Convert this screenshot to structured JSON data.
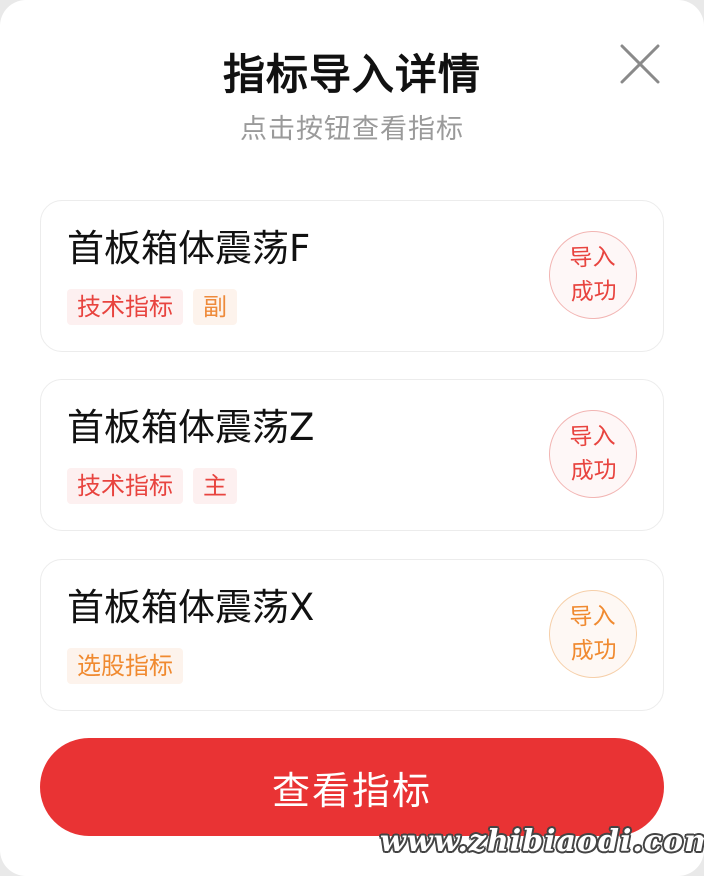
{
  "dialog": {
    "title": "指标导入详情",
    "subtitle": "点击按钮查看指标",
    "close_icon": "close-icon"
  },
  "items": [
    {
      "name": "首板箱体震荡F",
      "tags": [
        "技术指标",
        "副"
      ],
      "status_line1": "导入",
      "status_line2": "成功"
    },
    {
      "name": "首板箱体震荡Z",
      "tags": [
        "技术指标",
        "主"
      ],
      "status_line1": "导入",
      "status_line2": "成功"
    },
    {
      "name": "首板箱体震荡X",
      "tags": [
        "选股指标"
      ],
      "status_line1": "导入",
      "status_line2": "成功"
    }
  ],
  "footer": {
    "view_button_label": "查看指标",
    "watermark": "www.zhibiaodi.com"
  },
  "colors": {
    "accent_red": "#e93334",
    "tag_red": "#e8443f",
    "tag_orange": "#f08a30",
    "title": "#111111",
    "subtitle": "#9a9a9a"
  }
}
